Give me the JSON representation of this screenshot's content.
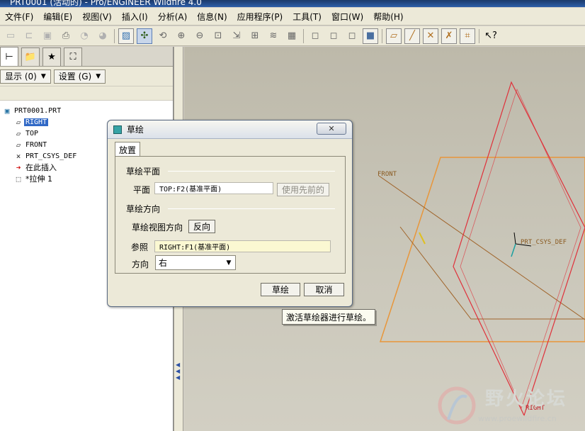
{
  "window": {
    "title": "PRT0001 (活动的) - Pro/ENGINEER Wildfire 4.0"
  },
  "menu": [
    "文件(F)",
    "编辑(E)",
    "视图(V)",
    "插入(I)",
    "分析(A)",
    "信息(N)",
    "应用程序(P)",
    "工具(T)",
    "窗口(W)",
    "帮助(H)"
  ],
  "toolbar_icons": [
    "new-icon",
    "open-icon",
    "save-icon",
    "print-icon",
    "send-icon",
    "send-mail-icon",
    "repaint-icon",
    "spin-center-icon",
    "orient-icon",
    "zoom-in-icon",
    "zoom-out-icon",
    "refit-icon",
    "reorient-icon",
    "saved-views-icon",
    "layers-icon",
    "view-manager-icon",
    "wireframe-icon",
    "hidden-line-icon",
    "no-hidden-icon",
    "shading-icon",
    "datum-planes-icon",
    "datum-axes-icon",
    "datum-points-icon",
    "coordinate-systems-icon",
    "annotation-icon",
    "context-help-icon"
  ],
  "panel": {
    "show_label": "显示 (0)",
    "settings_label": "设置 (G)",
    "tree": [
      {
        "label": "PRT0001.PRT",
        "icon": "part-icon"
      },
      {
        "label": "RIGHT",
        "icon": "datum-plane-icon",
        "selected": true
      },
      {
        "label": "TOP",
        "icon": "datum-plane-icon"
      },
      {
        "label": "FRONT",
        "icon": "datum-plane-icon"
      },
      {
        "label": "PRT_CSYS_DEF",
        "icon": "csys-icon"
      },
      {
        "label": "在此插入",
        "icon": "insert-here-icon"
      },
      {
        "label": "*拉伸 1",
        "icon": "extrude-icon"
      }
    ]
  },
  "graphics": {
    "front_label": "FRONT",
    "csys_label": "PRT_CSYS_DEF",
    "right_label": "RIGHT",
    "colors": {
      "right_plane": "#e0303a",
      "front_plane": "#a0642a",
      "top_plane": "#e8963a"
    }
  },
  "dialog": {
    "title": "草绘",
    "close_label": "✕",
    "tab_label": "放置",
    "sketch_plane_header": "草绘平面",
    "plane_label": "平面",
    "plane_value": "TOP:F2(基准平面)",
    "use_previous_label": "使用先前的",
    "orientation_header": "草绘方向",
    "view_direction_label": "草绘视图方向",
    "flip_label": "反向",
    "reference_label": "参照",
    "reference_value": "RIGHT:F1(基准平面)",
    "direction_label": "方向",
    "direction_value": "右",
    "sketch_button": "草绘",
    "cancel_button": "取消"
  },
  "tooltip": "激活草绘器进行草绘。",
  "watermark": {
    "title": "野火论坛",
    "url": "www.proewildfire.cn"
  }
}
